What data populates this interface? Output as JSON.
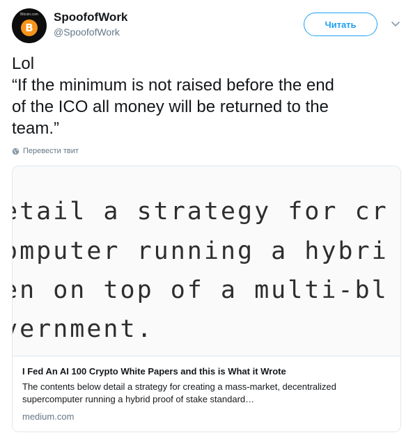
{
  "author": {
    "display_name": "SpoofofWork",
    "handle": "@SpoofofWork",
    "avatar_icon": "bitcoin-icon",
    "avatar_symbol": "B",
    "avatar_small_text": "Bitcoin.com"
  },
  "follow_button": {
    "label": "Читать"
  },
  "tweet": {
    "lines": [
      "Lol",
      "“If the minimum is not raised before the end",
      "of the ICO all money will be returned to the",
      "team.”"
    ]
  },
  "translate": {
    "label": "Перевести твит",
    "icon": "globe-icon"
  },
  "card": {
    "image_lines": [
      "etail a strategy for cr",
      "omputer running a hybri",
      "en on top of a multi-bl",
      "vernment."
    ],
    "title": "I Fed An AI 100 Crypto White Papers and this is What it Wrote",
    "description_lines": [
      "The contents below detail a strategy for creating a mass-market, decentralized",
      "supercomputer running a hybrid proof of stake standard…"
    ],
    "domain": "medium.com"
  },
  "colors": {
    "accent": "#1da1f2",
    "text": "#14171a",
    "secondary": "#657786",
    "border": "#e1e8ed",
    "bitcoin_orange": "#f7931a"
  }
}
